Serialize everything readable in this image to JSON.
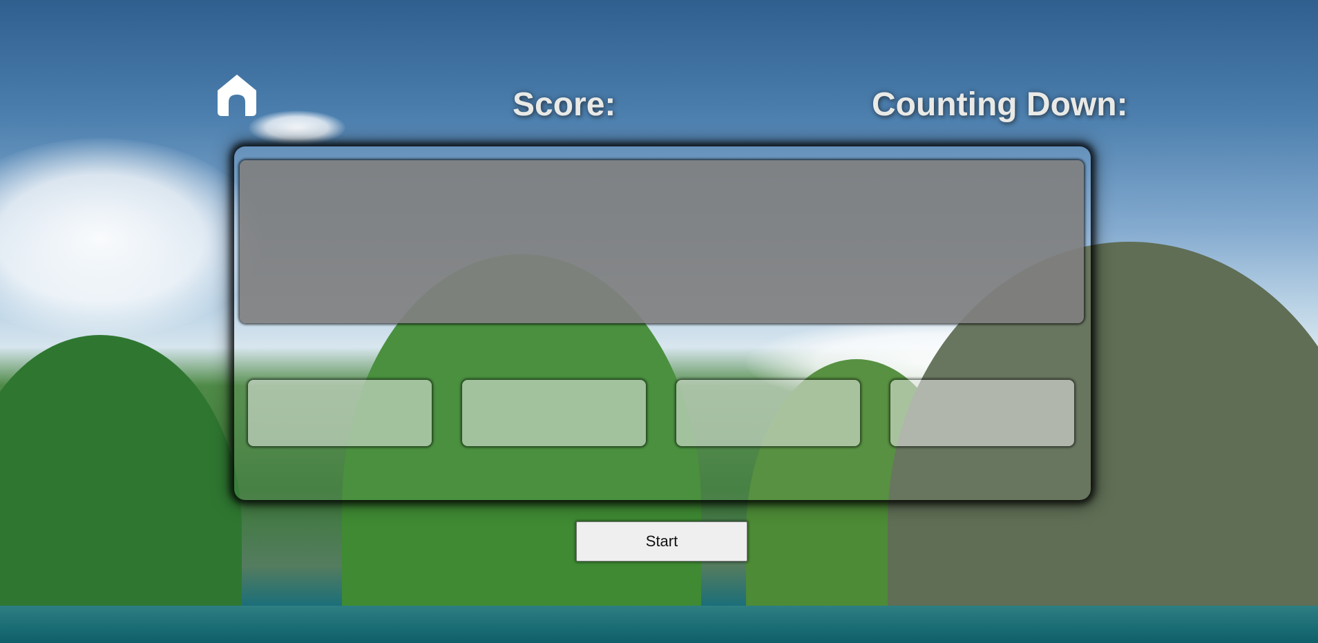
{
  "hud": {
    "score_label": "Score:",
    "countdown_label": "Counting Down:"
  },
  "game": {
    "question": "",
    "answers": [
      "",
      "",
      "",
      ""
    ]
  },
  "controls": {
    "start_label": "Start"
  },
  "icons": {
    "home": "home-icon"
  },
  "colors": {
    "hud_text": "#e9e9e6",
    "question_box": "#808080",
    "button_bg": "#efefef"
  }
}
